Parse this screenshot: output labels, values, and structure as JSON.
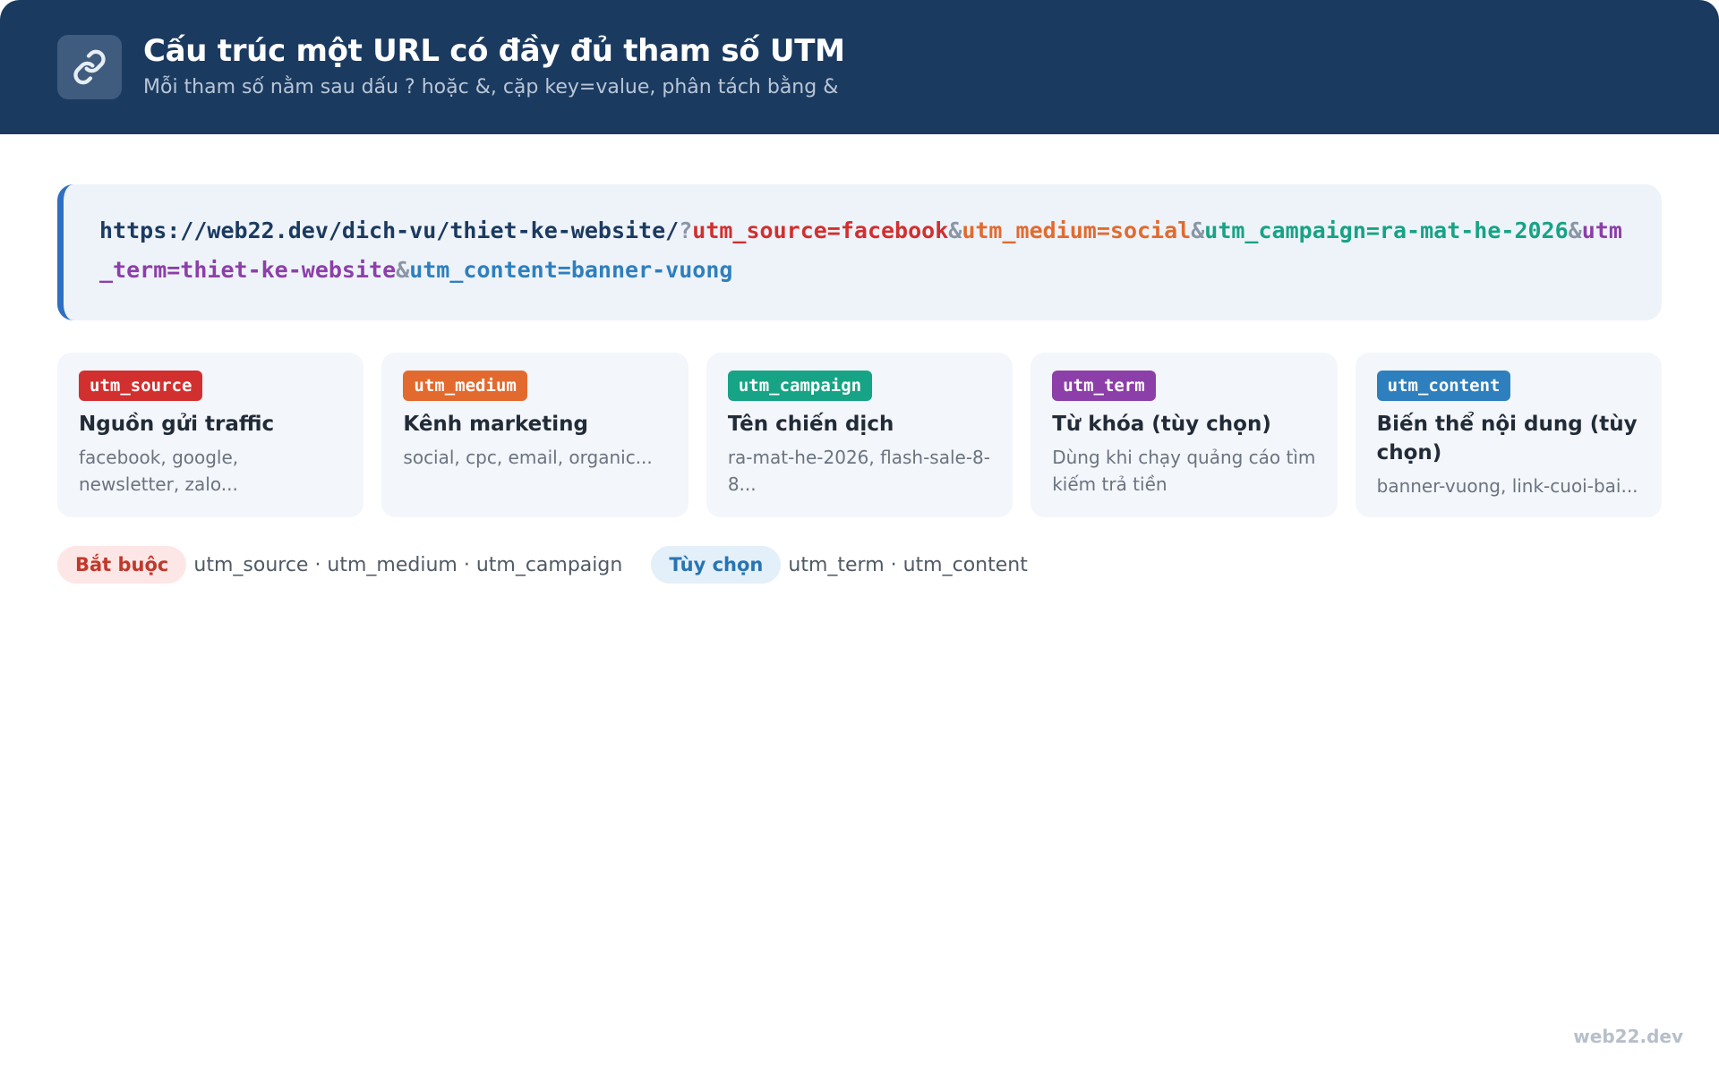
{
  "header": {
    "title": "Cấu trúc một URL có đầy đủ tham số UTM",
    "subtitle": "Mỗi tham số nằm sau dấu ? hoặc &, cặp key=value, phân tách bằng &",
    "icon": "link-icon"
  },
  "url": {
    "base": "https://web22.dev/dich-vu/thiet-ke-website/",
    "question": "?",
    "amp": "&",
    "params": {
      "source": "utm_source=facebook",
      "medium": "utm_medium=social",
      "campaign": "utm_campaign=ra-mat-he-2026",
      "term": "utm_term=thiet-ke-website",
      "content": "utm_content=banner-vuong"
    }
  },
  "cards": [
    {
      "badge": "utm_source",
      "title": "Nguồn gửi traffic",
      "desc": "facebook, google, newsletter, zalo...",
      "color": "#d22f2f"
    },
    {
      "badge": "utm_medium",
      "title": "Kênh marketing",
      "desc": "social, cpc, email, organic...",
      "color": "#e36a2e"
    },
    {
      "badge": "utm_campaign",
      "title": "Tên chiến dịch",
      "desc": "ra-mat-he-2026, flash-sale-8-8...",
      "color": "#17a385"
    },
    {
      "badge": "utm_term",
      "title": "Từ khóa (tùy chọn)",
      "desc": "Dùng khi chạy quảng cáo tìm kiếm trả tiền",
      "color": "#8c3fa8"
    },
    {
      "badge": "utm_content",
      "title": "Biến thể nội dung (tùy chọn)",
      "desc": "banner-vuong, link-cuoi-bai...",
      "color": "#2e7fbd"
    }
  ],
  "legend": {
    "required_label": "Bắt buộc",
    "required_text": "utm_source · utm_medium · utm_campaign",
    "optional_label": "Tùy chọn",
    "optional_text": "utm_term · utm_content"
  },
  "footer": {
    "brand": "web22.dev"
  }
}
